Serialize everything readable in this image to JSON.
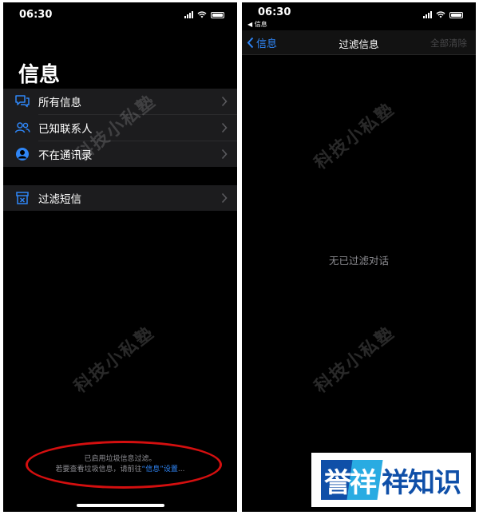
{
  "left_screen": {
    "status_time": "06:30",
    "title": "信息",
    "groups": [
      [
        {
          "label": "所有信息",
          "icon": "chat-bubbles-icon"
        },
        {
          "label": "已知联系人",
          "icon": "people-icon"
        },
        {
          "label": "不在通讯录",
          "icon": "unknown-person-icon"
        }
      ],
      [
        {
          "label": "过滤短信",
          "icon": "filter-bin-icon"
        }
      ]
    ],
    "footer_line1": "已启用垃圾信息过滤。",
    "footer_line2_prefix": "若要查看垃圾信息，请前往",
    "footer_line2_link": "“信息”设置",
    "footer_line2_suffix": "..."
  },
  "right_screen": {
    "status_time": "06:30",
    "back_app_label": "◀ 信息",
    "back_button_label": "信息",
    "nav_title": "过滤信息",
    "nav_right_label": "全部清除",
    "empty_message": "无已过滤对话"
  },
  "watermark_text": "科技小私塾",
  "logo": {
    "text_white": "誉祥",
    "text_blue": "祥知识"
  },
  "colors": {
    "accent": "#2f86f7",
    "annotation": "#d40f0f",
    "logo_blue": "#0f4fa8"
  }
}
